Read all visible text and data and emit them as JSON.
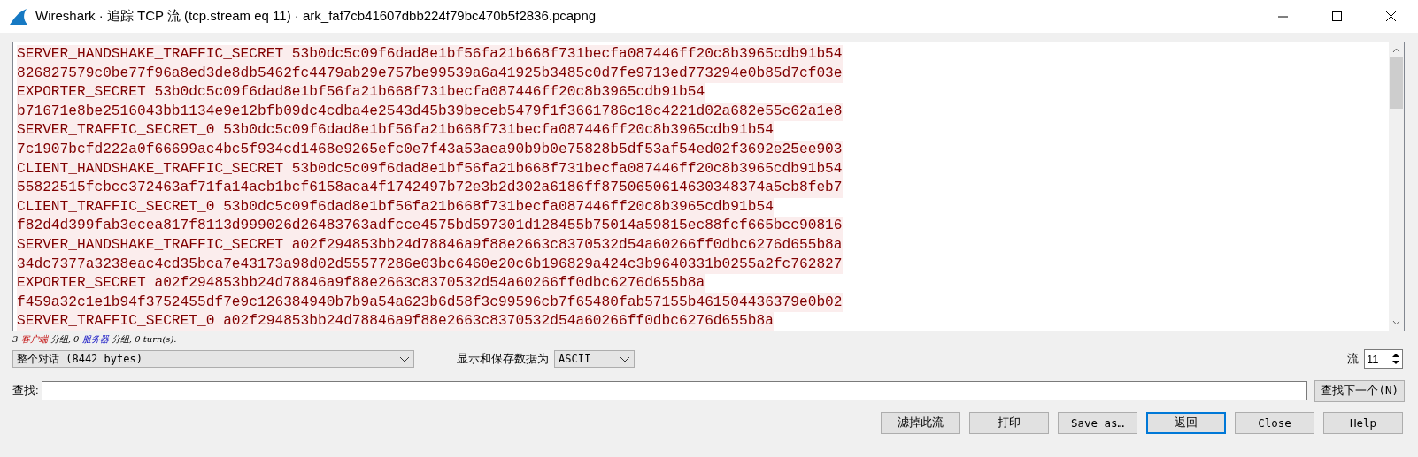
{
  "window": {
    "title": "Wireshark · 追踪 TCP 流 (tcp.stream eq 11) · ark_faf7cb41607dbb224f79bc470b5f2836.pcapng"
  },
  "stream_lines": [
    "SERVER_HANDSHAKE_TRAFFIC_SECRET 53b0dc5c09f6dad8e1bf56fa21b668f731becfa087446ff20c8b3965cdb91b54",
    "826827579c0be77f96a8ed3de8db5462fc4479ab29e757be99539a6a41925b3485c0d7fe9713ed773294e0b85d7cf03e",
    "EXPORTER_SECRET 53b0dc5c09f6dad8e1bf56fa21b668f731becfa087446ff20c8b3965cdb91b54",
    "b71671e8be2516043bb1134e9e12bfb09dc4cdba4e2543d45b39beceb5479f1f3661786c18c4221d02a682e55c62a1e8",
    "SERVER_TRAFFIC_SECRET_0 53b0dc5c09f6dad8e1bf56fa21b668f731becfa087446ff20c8b3965cdb91b54",
    "7c1907bcfd222a0f66699ac4bc5f934cd1468e9265efc0e7f43a53aea90b9b0e75828b5df53af54ed02f3692e25ee903",
    "CLIENT_HANDSHAKE_TRAFFIC_SECRET 53b0dc5c09f6dad8e1bf56fa21b668f731becfa087446ff20c8b3965cdb91b54",
    "55822515fcbcc372463af71fa14acb1bcf6158aca4f1742497b72e3b2d302a6186ff8750650614630348374a5cb8feb7",
    "CLIENT_TRAFFIC_SECRET_0 53b0dc5c09f6dad8e1bf56fa21b668f731becfa087446ff20c8b3965cdb91b54",
    "f82d4d399fab3ecea817f8113d999026d26483763adfcce4575bd597301d128455b75014a59815ec88fcf665bcc90816",
    "SERVER_HANDSHAKE_TRAFFIC_SECRET a02f294853bb24d78846a9f88e2663c8370532d54a60266ff0dbc6276d655b8a",
    "34dc7377a3238eac4cd35bca7e43173a98d02d55577286e03bc6460e20c6b196829a424c3b9640331b0255a2fc762827",
    "EXPORTER_SECRET a02f294853bb24d78846a9f88e2663c8370532d54a60266ff0dbc6276d655b8a",
    "f459a32c1e1b94f3752455df7e9c126384940b7b9a54a623b6d58f3c99596cb7f65480fab57155b461504436379e0b02",
    "SERVER_TRAFFIC_SECRET_0 a02f294853bb24d78846a9f88e2663c8370532d54a60266ff0dbc6276d655b8a"
  ],
  "summary": [
    {
      "kind": "plain",
      "text": "3 "
    },
    {
      "kind": "client",
      "text": "客户端"
    },
    {
      "kind": "plain",
      "text": " 分组, 0 "
    },
    {
      "kind": "server",
      "text": "服务器"
    },
    {
      "kind": "plain",
      "text": " 分组, 0 turn(s)."
    }
  ],
  "conversation_select": {
    "value": "整个对话 (8442 bytes)"
  },
  "format_label": "显示和保存数据为",
  "format_select": {
    "value": "ASCII"
  },
  "stream_label": "流",
  "stream_spin": {
    "value": "11"
  },
  "find_label": "查找:",
  "find_next": "查找下一个(N)",
  "buttons": [
    {
      "label": "滤掉此流",
      "selected": false
    },
    {
      "label": "打印",
      "selected": false
    },
    {
      "label": "Save as…",
      "selected": false
    },
    {
      "label": "返回",
      "selected": true
    },
    {
      "label": "Close",
      "selected": false
    },
    {
      "label": "Help",
      "selected": false
    }
  ]
}
